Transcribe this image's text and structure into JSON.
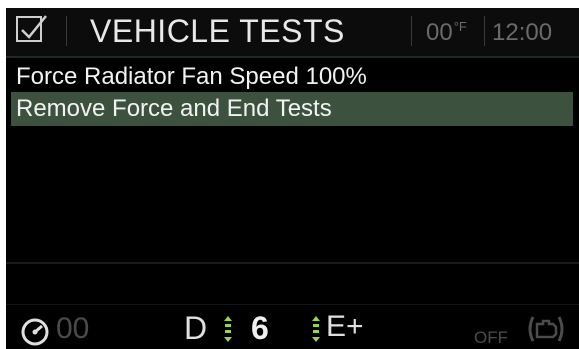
{
  "header": {
    "icon": "checkbox-checked-icon",
    "title": "VEHICLE TESTS",
    "temperature": "00",
    "temperature_unit": "°F",
    "time": "12:00"
  },
  "menu": {
    "items": [
      {
        "label": "Force Radiator Fan Speed 100%",
        "selected": false
      },
      {
        "label": "Remove Force and End Tests",
        "selected": true
      }
    ]
  },
  "status_bar": {
    "speedometer_icon": "speedometer-icon",
    "speed": "00",
    "gear": "D",
    "gear_number": "6",
    "mode": "E+",
    "engine_state": "OFF",
    "engine_icon": "engine-icon"
  },
  "colors": {
    "background": "#000000",
    "selection": "#3c523e",
    "shift_arrow": "#9bd34a",
    "text": "#f2f2f2",
    "dim_text": "#6a6a6a"
  }
}
